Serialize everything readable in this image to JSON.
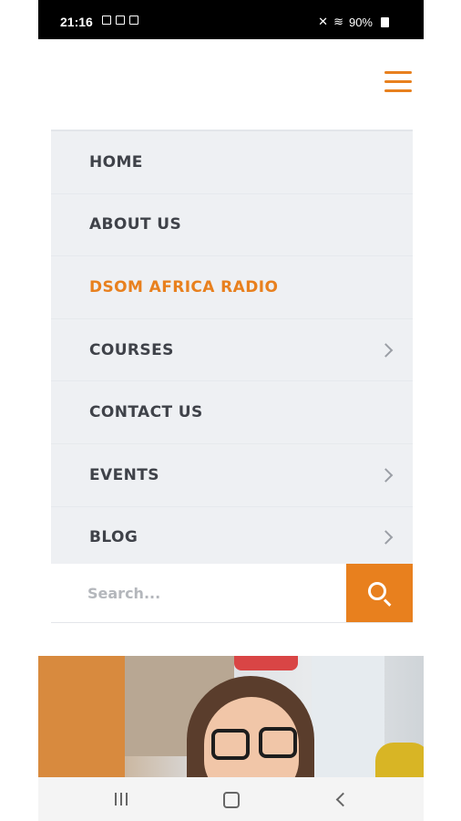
{
  "status_bar": {
    "time": "21:16",
    "battery": "90%"
  },
  "menu": {
    "items": [
      {
        "label": "HOME",
        "active": false,
        "has_submenu": false
      },
      {
        "label": "ABOUT US",
        "active": false,
        "has_submenu": false
      },
      {
        "label": "DSOM AFRICA RADIO",
        "active": true,
        "has_submenu": false
      },
      {
        "label": "COURSES",
        "active": false,
        "has_submenu": true
      },
      {
        "label": "CONTACT US",
        "active": false,
        "has_submenu": false
      },
      {
        "label": "EVENTS",
        "active": false,
        "has_submenu": true
      },
      {
        "label": "BLOG",
        "active": false,
        "has_submenu": true
      }
    ]
  },
  "search": {
    "placeholder": "Search...",
    "value": ""
  },
  "icons": {
    "menu": "hamburger-icon",
    "search": "search-icon",
    "submenu": "chevron-right-icon",
    "nav_recent": "recent-apps-icon",
    "nav_home": "home-icon",
    "nav_back": "back-icon"
  },
  "colors": {
    "accent": "#e8801e",
    "menu_bg": "#eef0f3",
    "menu_text": "#3f4249"
  }
}
